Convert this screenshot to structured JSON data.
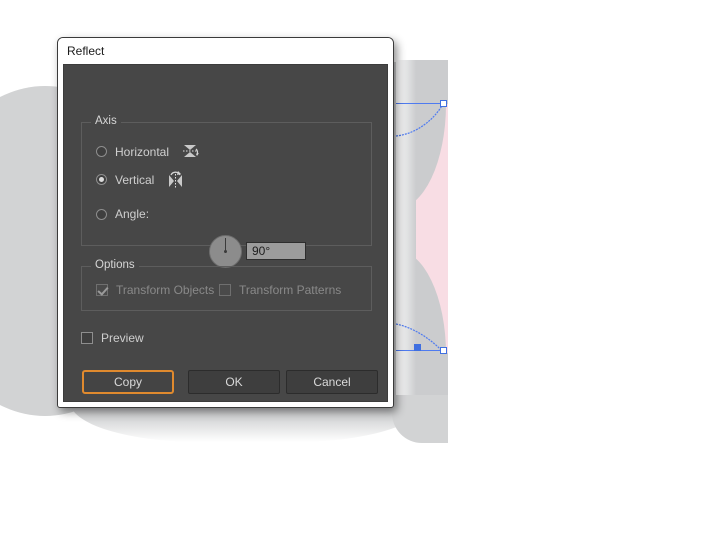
{
  "dialog": {
    "title": "Reflect",
    "axis_group": {
      "label": "Axis",
      "options": [
        {
          "label": "Horizontal",
          "selected": false,
          "icon": "reflect-horizontal-icon"
        },
        {
          "label": "Vertical",
          "selected": true,
          "icon": "reflect-vertical-icon"
        },
        {
          "label": "Angle:",
          "selected": false,
          "icon": "angle-dial-icon"
        }
      ],
      "angle_value": "90°",
      "dial_degrees": 90
    },
    "options_group": {
      "label": "Options",
      "checkboxes": [
        {
          "label": "Transform Objects",
          "checked": true,
          "enabled": false
        },
        {
          "label": "Transform Patterns",
          "checked": false,
          "enabled": false
        }
      ]
    },
    "preview": {
      "label": "Preview",
      "checked": false
    },
    "buttons": {
      "copy": "Copy",
      "ok": "OK",
      "cancel": "Cancel"
    },
    "colors": {
      "focus_accent": "#e08a2e",
      "panel_bg": "#474747",
      "titlebar_bg": "#ffffff",
      "text": "#cfcfcf",
      "disabled_text": "#898989",
      "input_bg": "#9c9c9c"
    }
  },
  "canvas": {
    "artwork_colors": {
      "shape_grey": "#cfd0d2",
      "shape_pink": "#f8dde4",
      "path_blue": "#4f7bf0",
      "background": "#ffffff"
    }
  }
}
